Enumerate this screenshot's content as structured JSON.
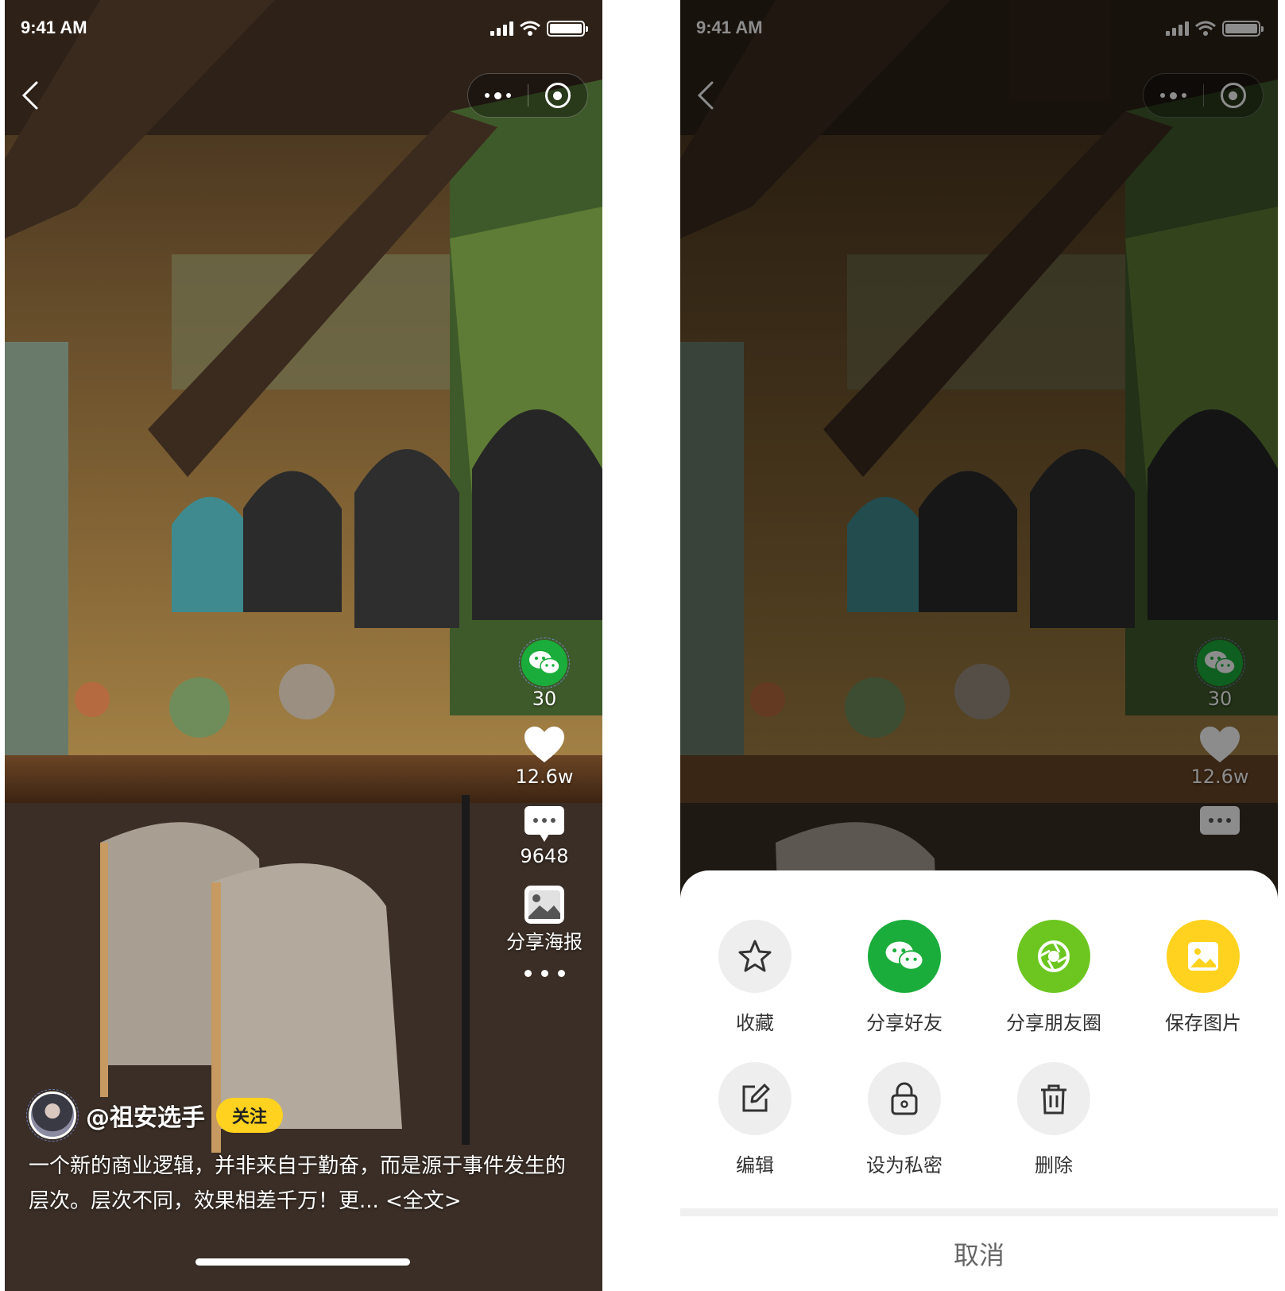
{
  "status_bar": {
    "time": "9:41 AM"
  },
  "post": {
    "author": "@祖安选手",
    "follow_label": "关注",
    "caption": "一个新的商业逻辑，并非来自于勤奋，而是源于事件发生的层次。层次不同，效果相差千万！更... <全文>"
  },
  "actions": {
    "wechat_count": "30",
    "like_count": "12.6w",
    "comment_count": "9648",
    "poster_label": "分享海报"
  },
  "share_sheet": {
    "items": [
      {
        "label": "收藏",
        "icon": "star-icon",
        "color": "#eeeeee"
      },
      {
        "label": "分享好友",
        "icon": "wechat-icon",
        "color": "#1aad3b"
      },
      {
        "label": "分享朋友圈",
        "icon": "moments-icon",
        "color": "#6cc61f"
      },
      {
        "label": "保存图片",
        "icon": "image-icon",
        "color": "#ffd21f"
      },
      {
        "label": "编辑",
        "icon": "edit-icon",
        "color": "#eeeeee"
      },
      {
        "label": "设为私密",
        "icon": "lock-icon",
        "color": "#eeeeee"
      },
      {
        "label": "删除",
        "icon": "trash-icon",
        "color": "#eeeeee"
      }
    ],
    "cancel_label": "取消"
  }
}
